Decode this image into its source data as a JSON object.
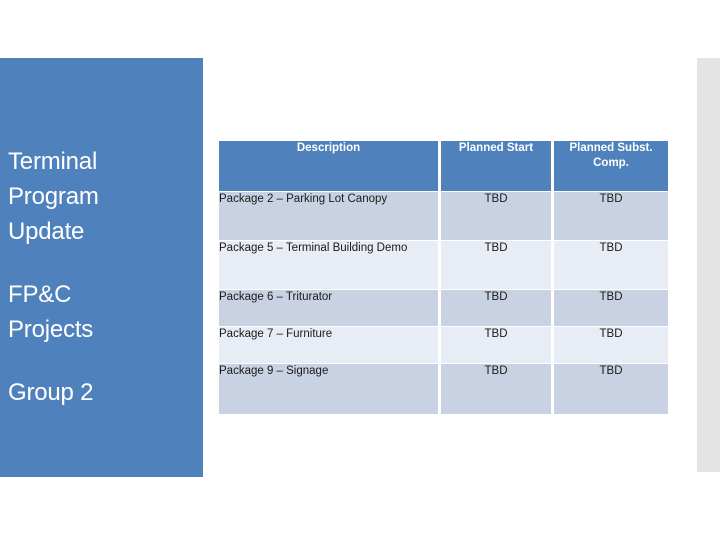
{
  "slide": {
    "background_color": "#ffffff",
    "accent_color": "#4F81BD",
    "right_bar_color": "#E4E4E4"
  },
  "title_panel": {
    "background_color": "#4F81BD",
    "lines_group_1": [
      "Terminal",
      "Program",
      "Update"
    ],
    "lines_group_2": [
      "FP&C",
      "Projects"
    ],
    "lines_group_3": [
      "Group 2"
    ]
  },
  "table": {
    "header_background": "#4F81BD",
    "header_text_color": "#FFFFFF",
    "row_band_dark": "#C9D2E3",
    "row_band_light": "#E8ECF4",
    "columns": [
      "Description",
      "Planned Start",
      "Planned Subst. Comp."
    ],
    "header_cells": [
      {
        "text": "Description"
      },
      {
        "text": "Planned Start"
      },
      {
        "line1": "Planned Subst.",
        "line2": "Comp."
      }
    ],
    "rows": [
      {
        "description": "Package 2 – Parking Lot Canopy",
        "planned_start": "TBD",
        "planned_subst_comp": "TBD"
      },
      {
        "description": "Package 5 – Terminal Building Demo",
        "planned_start": "TBD",
        "planned_subst_comp": "TBD"
      },
      {
        "description": "Package 6 – Triturator",
        "planned_start": "TBD",
        "planned_subst_comp": "TBD"
      },
      {
        "description": "Package 7 – Furniture",
        "planned_start": "TBD",
        "planned_subst_comp": "TBD"
      },
      {
        "description": "Package 9 – Signage",
        "planned_start": "TBD",
        "planned_subst_comp": "TBD"
      }
    ]
  }
}
